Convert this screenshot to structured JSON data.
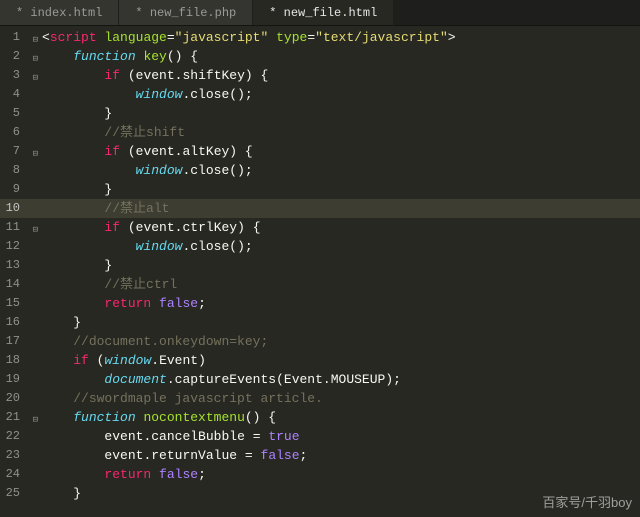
{
  "tabs": [
    {
      "label": "* index.html",
      "active": false
    },
    {
      "label": "* new_file.php",
      "active": false
    },
    {
      "label": "* new_file.html",
      "active": true
    }
  ],
  "highlight_line": 10,
  "code": [
    {
      "n": 1,
      "fold": true,
      "tokens": [
        [
          "punct",
          "<"
        ],
        [
          "tag",
          "script"
        ],
        [
          "id",
          " "
        ],
        [
          "attr",
          "language"
        ],
        [
          "op",
          "="
        ],
        [
          "str",
          "\"javascript\""
        ],
        [
          "id",
          " "
        ],
        [
          "attr",
          "type"
        ],
        [
          "op",
          "="
        ],
        [
          "str",
          "\"text/javascript\""
        ],
        [
          "punct",
          ">"
        ]
      ]
    },
    {
      "n": 2,
      "fold": true,
      "tokens": [
        [
          "id",
          "    "
        ],
        [
          "kw",
          "function"
        ],
        [
          "id",
          " "
        ],
        [
          "fn",
          "key"
        ],
        [
          "punct",
          "()"
        ],
        [
          "id",
          " "
        ],
        [
          "punct",
          "{"
        ]
      ]
    },
    {
      "n": 3,
      "fold": true,
      "tokens": [
        [
          "id",
          "        "
        ],
        [
          "kw2",
          "if"
        ],
        [
          "id",
          " "
        ],
        [
          "punct",
          "("
        ],
        [
          "id",
          "event"
        ],
        [
          "punct",
          "."
        ],
        [
          "id",
          "shiftKey"
        ],
        [
          "punct",
          ")"
        ],
        [
          "id",
          " "
        ],
        [
          "punct",
          "{"
        ]
      ]
    },
    {
      "n": 4,
      "tokens": [
        [
          "id",
          "            "
        ],
        [
          "kw",
          "window"
        ],
        [
          "punct",
          "."
        ],
        [
          "id",
          "close"
        ],
        [
          "punct",
          "();"
        ]
      ]
    },
    {
      "n": 5,
      "tokens": [
        [
          "id",
          "        "
        ],
        [
          "punct",
          "}"
        ]
      ]
    },
    {
      "n": 6,
      "tokens": [
        [
          "id",
          "        "
        ],
        [
          "comm",
          "//禁止shift"
        ]
      ]
    },
    {
      "n": 7,
      "fold": true,
      "tokens": [
        [
          "id",
          "        "
        ],
        [
          "kw2",
          "if"
        ],
        [
          "id",
          " "
        ],
        [
          "punct",
          "("
        ],
        [
          "id",
          "event"
        ],
        [
          "punct",
          "."
        ],
        [
          "id",
          "altKey"
        ],
        [
          "punct",
          ")"
        ],
        [
          "id",
          " "
        ],
        [
          "punct",
          "{"
        ]
      ]
    },
    {
      "n": 8,
      "tokens": [
        [
          "id",
          "            "
        ],
        [
          "kw",
          "window"
        ],
        [
          "punct",
          "."
        ],
        [
          "id",
          "close"
        ],
        [
          "punct",
          "();"
        ]
      ]
    },
    {
      "n": 9,
      "tokens": [
        [
          "id",
          "        "
        ],
        [
          "punct",
          "}"
        ]
      ]
    },
    {
      "n": 10,
      "tokens": [
        [
          "id",
          "        "
        ],
        [
          "comm",
          "//禁止alt"
        ]
      ]
    },
    {
      "n": 11,
      "fold": true,
      "tokens": [
        [
          "id",
          "        "
        ],
        [
          "kw2",
          "if"
        ],
        [
          "id",
          " "
        ],
        [
          "punct",
          "("
        ],
        [
          "id",
          "event"
        ],
        [
          "punct",
          "."
        ],
        [
          "id",
          "ctrlKey"
        ],
        [
          "punct",
          ")"
        ],
        [
          "id",
          " "
        ],
        [
          "punct",
          "{"
        ]
      ]
    },
    {
      "n": 12,
      "tokens": [
        [
          "id",
          "            "
        ],
        [
          "kw",
          "window"
        ],
        [
          "punct",
          "."
        ],
        [
          "id",
          "close"
        ],
        [
          "punct",
          "();"
        ]
      ]
    },
    {
      "n": 13,
      "tokens": [
        [
          "id",
          "        "
        ],
        [
          "punct",
          "}"
        ]
      ]
    },
    {
      "n": 14,
      "tokens": [
        [
          "id",
          "        "
        ],
        [
          "comm",
          "//禁止ctrl"
        ]
      ]
    },
    {
      "n": 15,
      "tokens": [
        [
          "id",
          "        "
        ],
        [
          "kw2",
          "return"
        ],
        [
          "id",
          " "
        ],
        [
          "const",
          "false"
        ],
        [
          "punct",
          ";"
        ]
      ]
    },
    {
      "n": 16,
      "tokens": [
        [
          "id",
          "    "
        ],
        [
          "punct",
          "}"
        ]
      ]
    },
    {
      "n": 17,
      "tokens": [
        [
          "id",
          "    "
        ],
        [
          "comm",
          "//document.onkeydown=key;"
        ]
      ]
    },
    {
      "n": 18,
      "tokens": [
        [
          "id",
          "    "
        ],
        [
          "kw2",
          "if"
        ],
        [
          "id",
          " "
        ],
        [
          "punct",
          "("
        ],
        [
          "kw",
          "window"
        ],
        [
          "punct",
          "."
        ],
        [
          "id",
          "Event"
        ],
        [
          "punct",
          ")"
        ]
      ]
    },
    {
      "n": 19,
      "tokens": [
        [
          "id",
          "        "
        ],
        [
          "kw",
          "document"
        ],
        [
          "punct",
          "."
        ],
        [
          "id",
          "captureEvents"
        ],
        [
          "punct",
          "("
        ],
        [
          "id",
          "Event"
        ],
        [
          "punct",
          "."
        ],
        [
          "id",
          "MOUSEUP"
        ],
        [
          "punct",
          ");"
        ]
      ]
    },
    {
      "n": 20,
      "tokens": [
        [
          "id",
          "    "
        ],
        [
          "comm",
          "//swordmaple javascript article."
        ]
      ]
    },
    {
      "n": 21,
      "fold": true,
      "tokens": [
        [
          "id",
          "    "
        ],
        [
          "kw",
          "function"
        ],
        [
          "id",
          " "
        ],
        [
          "fn",
          "nocontextmenu"
        ],
        [
          "punct",
          "()"
        ],
        [
          "id",
          " "
        ],
        [
          "punct",
          "{"
        ]
      ]
    },
    {
      "n": 22,
      "tokens": [
        [
          "id",
          "        "
        ],
        [
          "id",
          "event"
        ],
        [
          "punct",
          "."
        ],
        [
          "id",
          "cancelBubble"
        ],
        [
          "id",
          " "
        ],
        [
          "op",
          "="
        ],
        [
          "id",
          " "
        ],
        [
          "const",
          "true"
        ]
      ]
    },
    {
      "n": 23,
      "tokens": [
        [
          "id",
          "        "
        ],
        [
          "id",
          "event"
        ],
        [
          "punct",
          "."
        ],
        [
          "id",
          "returnValue"
        ],
        [
          "id",
          " "
        ],
        [
          "op",
          "="
        ],
        [
          "id",
          " "
        ],
        [
          "const",
          "false"
        ],
        [
          "punct",
          ";"
        ]
      ]
    },
    {
      "n": 24,
      "tokens": [
        [
          "id",
          "        "
        ],
        [
          "kw2",
          "return"
        ],
        [
          "id",
          " "
        ],
        [
          "const",
          "false"
        ],
        [
          "punct",
          ";"
        ]
      ]
    },
    {
      "n": 25,
      "tokens": [
        [
          "id",
          "    "
        ],
        [
          "punct",
          "}"
        ]
      ]
    }
  ],
  "watermark": "百家号/千羽boy"
}
